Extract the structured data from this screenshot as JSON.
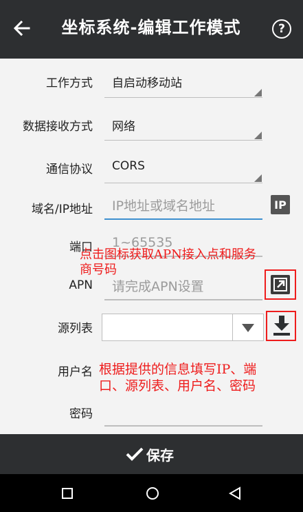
{
  "header": {
    "title": "坐标系统-编辑工作模式",
    "help_label": "?"
  },
  "form": {
    "work_mode": {
      "label": "工作方式",
      "value": "自启动移动站"
    },
    "data_receive": {
      "label": "数据接收方式",
      "value": "网络"
    },
    "protocol": {
      "label": "通信协议",
      "value": "CORS"
    },
    "domain": {
      "label": "域名/IP地址",
      "placeholder": "IP地址或域名地址",
      "badge": "IP"
    },
    "port": {
      "label": "端口",
      "placeholder": "1~65535"
    },
    "apn": {
      "label": "APN",
      "placeholder": "请完成APN设置"
    },
    "source_table": {
      "label": "源列表",
      "value": ""
    },
    "username": {
      "label": "用户名"
    },
    "password": {
      "label": "密码"
    }
  },
  "annotations": {
    "apn_hint_line1": "点击图标获取APN接入点和服务",
    "apn_hint_line2": "商号码",
    "fill_hint_line1": "根据提供的信息填写IP、端",
    "fill_hint_line2": "口、源列表、用户名、密码"
  },
  "footer": {
    "save_label": "保存"
  },
  "colors": {
    "appbar": "#2d2f31",
    "annotation": "#ee1c1c",
    "focus_line": "#3d8fcf"
  }
}
